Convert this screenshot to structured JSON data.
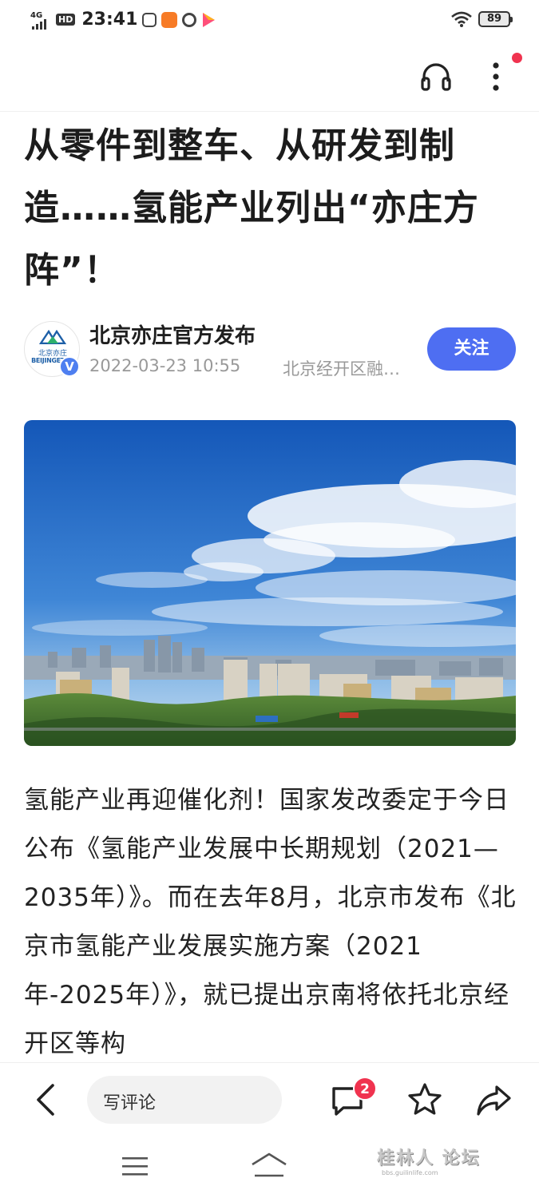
{
  "status_bar": {
    "network": "4G",
    "hd_badge": "HD",
    "time": "23:41",
    "battery": "89",
    "icons": [
      "camera-app-icon",
      "orange-app-icon",
      "ring-app-icon",
      "play-app-icon",
      "wifi-icon"
    ]
  },
  "top_bar": {
    "icons": [
      "headphone-icon",
      "more-vertical-icon"
    ],
    "notification_dot_color": "#f0334f"
  },
  "article": {
    "title": "从零件到整车、从研发到制造……氢能产业列出“亦庄方阵”！",
    "author": {
      "name": "北京亦庄官方发布",
      "avatar_text_cn": "北京亦庄",
      "avatar_text_en": "BEIJINGETDZ",
      "verified": "V",
      "time": "2022-03-23 10:55",
      "source": "北京经开区融…"
    },
    "follow_label": "关注",
    "body": "氢能产业再迎催化剂！国家发改委定于今日公布《氢能产业发展中长期规划（2021—2035年）》。而在去年8月，北京市发布《北京市氢能产业发展实施方案（2021年-2025年）》，就已提出京南将依托北京经开区等构"
  },
  "action_bar": {
    "comment_placeholder": "写评论",
    "comment_count": "2",
    "accent_color": "#4e6ef2"
  },
  "system_nav": {
    "watermark": "桂林人 论坛",
    "watermark_sub": "bbs.guilinlife.com"
  }
}
